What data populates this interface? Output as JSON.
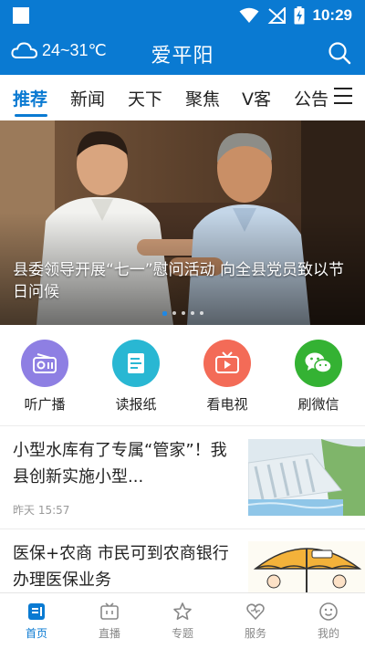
{
  "status_bar": {
    "time": "10:29"
  },
  "header": {
    "weather": "24~31℃",
    "title": "爱平阳"
  },
  "tabs": [
    {
      "label": "推荐",
      "active": true
    },
    {
      "label": "新闻"
    },
    {
      "label": "天下"
    },
    {
      "label": "聚焦"
    },
    {
      "label": "V客"
    },
    {
      "label": "公告"
    }
  ],
  "banner": {
    "caption": "县委领导开展“七一”慰问活动 向全县党员致以节日问候",
    "slide_count": 5,
    "active_slide": 1
  },
  "quick_entries": [
    {
      "label": "听广播",
      "icon": "radio-icon",
      "color": "#8e7fe3"
    },
    {
      "label": "读报纸",
      "icon": "newspaper-icon",
      "color": "#29b7d3"
    },
    {
      "label": "看电视",
      "icon": "tv-icon",
      "color": "#f36b57"
    },
    {
      "label": "刷微信",
      "icon": "wechat-icon",
      "color": "#34b233"
    }
  ],
  "news": [
    {
      "title": "小型水库有了专属“管家”！我县创新实施小型...",
      "time": "昨天 15:57",
      "thumb": "reservoir-dam-image"
    },
    {
      "title": "医保+农商 市民可到农商银行办理医保业务",
      "thumb": "umbrella-cartoon-image"
    }
  ],
  "bottom_nav": [
    {
      "label": "首页",
      "icon": "home-icon",
      "active": true
    },
    {
      "label": "直播",
      "icon": "live-tv-icon"
    },
    {
      "label": "专题",
      "icon": "star-icon"
    },
    {
      "label": "服务",
      "icon": "heart-icon"
    },
    {
      "label": "我的",
      "icon": "profile-icon"
    }
  ],
  "colors": {
    "brand": "#0a7ad2",
    "inactive_nav": "#888888",
    "time_gray": "#999999"
  }
}
